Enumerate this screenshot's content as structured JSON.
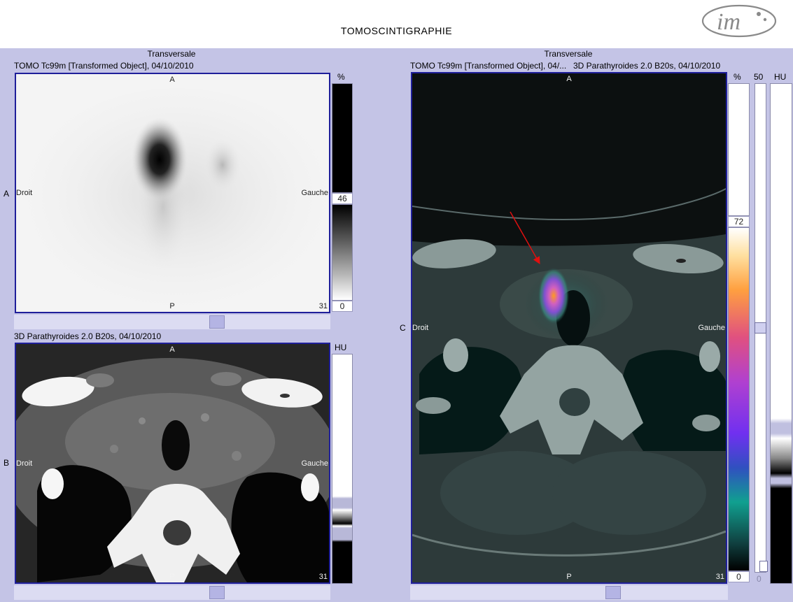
{
  "app": {
    "title": "TOMOSCINTIGRAPHIE"
  },
  "panels": {
    "spect": {
      "heading": "Transversale",
      "series": "TOMO Tc99m [Transformed Object], 04/10/2010",
      "row_label": "A",
      "orient": {
        "top": "A",
        "bottom": "P",
        "left": "Droit",
        "right": "Gauche"
      },
      "slice": "31",
      "unit": "%",
      "window_max": "46",
      "window_min": "0"
    },
    "ct": {
      "series": "3D Parathyroides  2.0  B20s, 04/10/2010",
      "row_label": "B",
      "orient": {
        "top": "A",
        "bottom": "P",
        "left": "Droit",
        "right": "Gauche"
      },
      "slice": "31",
      "unit": "HU"
    },
    "fusion": {
      "heading": "Transversale",
      "series_pet": "TOMO Tc99m [Transformed Object], 04/...",
      "series_ct": "3D Parathyroides  2.0  B20s, 04/10/2010",
      "row_label": "C",
      "orient": {
        "top": "A",
        "bottom": "P",
        "left": "Droit",
        "right": "Gauche"
      },
      "slice": "31",
      "unit_pct": "%",
      "window_max": "72",
      "window_min": "0",
      "blend_max": "50",
      "blend_min": "0",
      "unit_hu": "HU"
    }
  },
  "colors": {
    "frame_border": "#1f1f9a",
    "background": "#c4c4e6",
    "arrow": "#e01010"
  },
  "icons": {
    "logo": "im-logo",
    "arrow": "red-arrow-annotation"
  }
}
